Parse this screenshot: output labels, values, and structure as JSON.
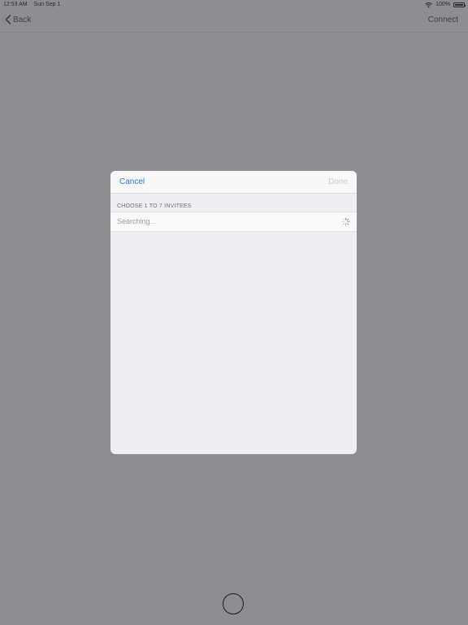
{
  "status_bar": {
    "time": "12:53 AM",
    "date": "Sun Sep 1",
    "battery": "100%"
  },
  "nav_bar": {
    "back_label": "Back",
    "action_label": "Connect"
  },
  "modal": {
    "cancel_label": "Cancel",
    "done_label": "Done",
    "section_header": "CHOOSE 1 TO 7 INVITEES",
    "searching_text": "Searching…"
  },
  "colors": {
    "accent": "#1d7ce0",
    "dimmed_background": "#8e8e92"
  }
}
